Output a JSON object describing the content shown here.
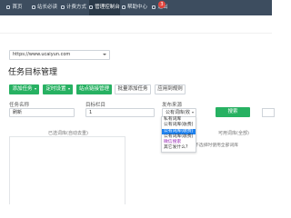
{
  "nav": {
    "items": [
      {
        "label": "首页",
        "active": false
      },
      {
        "label": "站长必读",
        "active": false
      },
      {
        "label": "计费方式",
        "active": false
      },
      {
        "label": "管理控制台",
        "active": true
      },
      {
        "label": "帮助中心",
        "active": false
      },
      {
        "label": "退出",
        "active": false
      }
    ],
    "badge": "3"
  },
  "site_select": {
    "value": "https://www.ucaiyun.com",
    "caret_icon": "chevron-down-icon"
  },
  "page_title": "任务目标管理",
  "buttons": {
    "add_task": "添加任务",
    "timing": "定时设置",
    "link_check": "站点链接管理",
    "batch_add": "批量添加任务",
    "apply_rules": "应用到规则"
  },
  "filters": {
    "task_name_label": "任务名称",
    "task_name_value": "刷新",
    "target_col_label": "目标栏目",
    "target_col_value": "1",
    "publish_label": "发布来源",
    "publish_value": "公有词库(收费)",
    "query_button": "搜索"
  },
  "dropdown": {
    "options": [
      {
        "label": "私有词库",
        "state": "normal"
      },
      {
        "label": "公有词库(收费)",
        "state": "normal"
      },
      {
        "label": "公有词库(收费)",
        "state": "selected"
      },
      {
        "label": "公有词库(收费)",
        "state": "normal"
      },
      {
        "label": "微信搜索",
        "state": "purple"
      },
      {
        "label": "其它发什么?",
        "state": "normal"
      }
    ]
  },
  "panels": {
    "left_title": "已选词库(自动去重)",
    "right_title": "可用词库(全部)",
    "right_note": "不选择时使用全部词库"
  },
  "colors": {
    "topbar": "#3d4d5f",
    "active_nav": "#2b3a49",
    "accent_green": "#27b162",
    "selected_blue": "#1e82f0",
    "badge_red": "#e0463f"
  }
}
